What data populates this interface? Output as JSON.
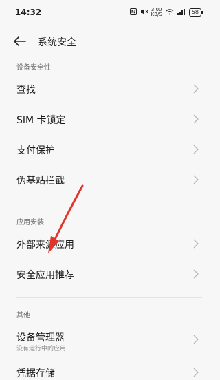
{
  "status_bar": {
    "time": "14:32",
    "net_speed_value": "3.00",
    "net_speed_unit": "KB/S",
    "battery": "58"
  },
  "header": {
    "back_icon": "back-arrow-icon",
    "title": "系统安全"
  },
  "sections": {
    "device_security": {
      "label": "设备安全性",
      "items": [
        {
          "label": "查找"
        },
        {
          "label": "SIM 卡锁定"
        },
        {
          "label": "支付保护"
        },
        {
          "label": "伪基站拦截"
        }
      ]
    },
    "app_security": {
      "label": "应用安装",
      "items": [
        {
          "label": "外部来源应用"
        },
        {
          "label": "安全应用推荐"
        }
      ]
    },
    "other": {
      "label": "其他",
      "items": [
        {
          "label": "设备管理器",
          "subtitle": "没有运行中的应用"
        },
        {
          "label": "凭据存储"
        }
      ]
    }
  },
  "annotation": {
    "arrow_color": "#e0352b"
  }
}
